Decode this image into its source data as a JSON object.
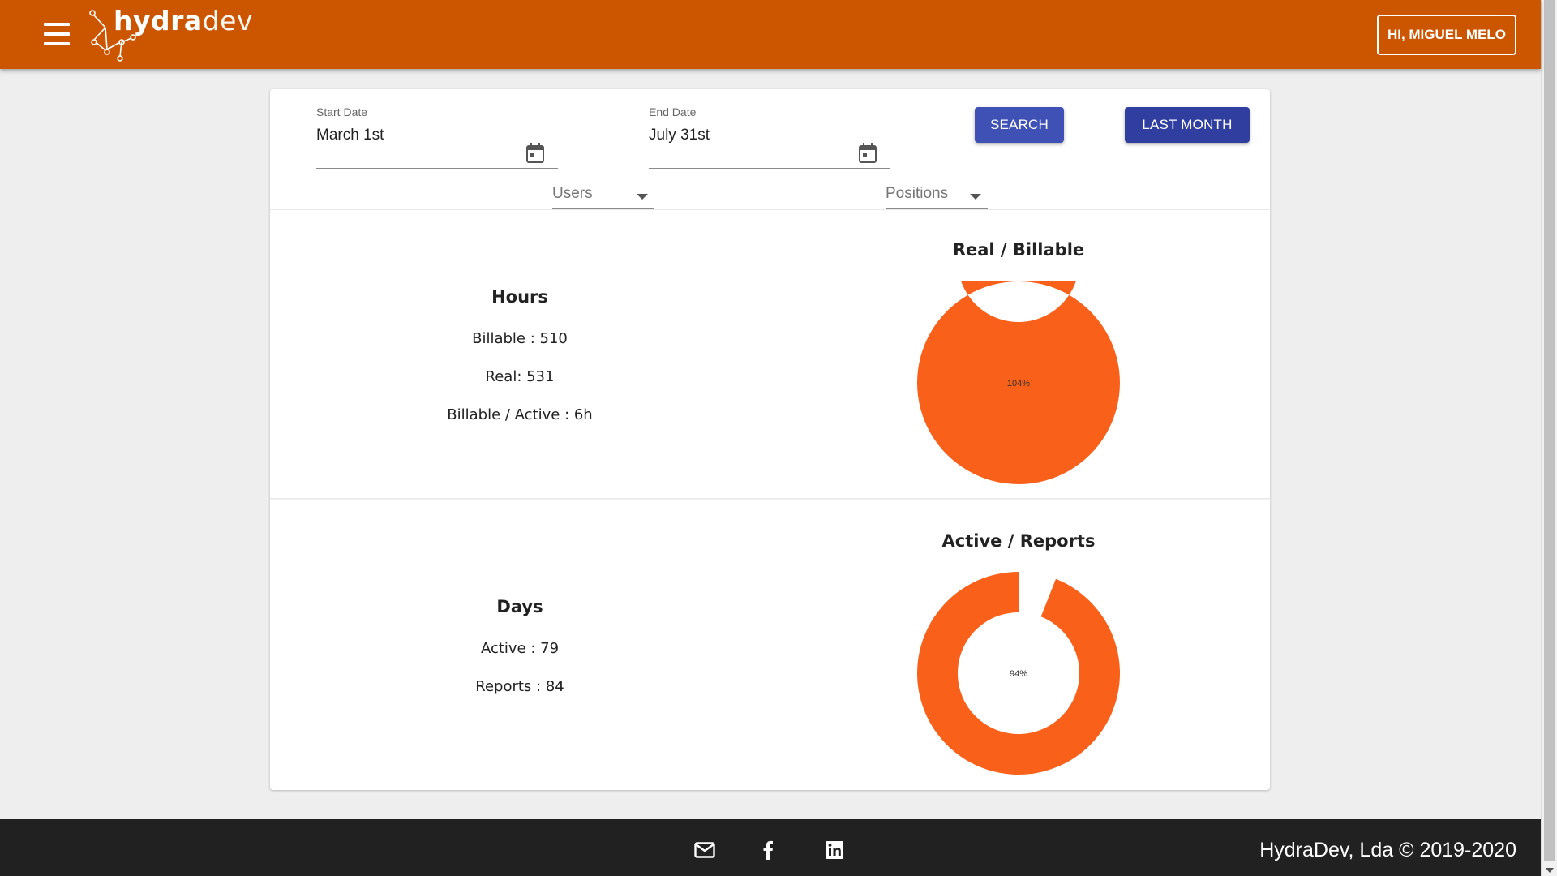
{
  "header": {
    "brand_bold": "hydra",
    "brand_light": "dev",
    "greeting": "HI, MIGUEL MELO",
    "icons": [
      "menu-icon",
      "hydradev-logo"
    ]
  },
  "filters": {
    "start_date": {
      "label": "Start Date",
      "value": "March 1st"
    },
    "end_date": {
      "label": "End Date",
      "value": "July 31st"
    },
    "search_label": "SEARCH",
    "last_month_label": "LAST MONTH",
    "users_select": "Users",
    "positions_select": "Positions"
  },
  "hours": {
    "title": "Hours",
    "billable": "Billable : 510",
    "real": "Real: 531",
    "billable_active": "Billable / Active : 6h"
  },
  "days": {
    "title": "Days",
    "active": "Active : 79",
    "reports": "Reports : 84"
  },
  "chart_data": [
    {
      "type": "pie",
      "title": "Real / Billable",
      "center_label": "104%",
      "percent": 104,
      "color": "#f9601a"
    },
    {
      "type": "pie",
      "title": "Active / Reports",
      "center_label": "94%",
      "percent": 94,
      "color": "#f9601a"
    }
  ],
  "footer": {
    "copyright": "HydraDev, Lda © 2019-2020",
    "icons": [
      "email-icon",
      "facebook-icon",
      "linkedin-icon"
    ]
  },
  "colors": {
    "header": "#cc5500",
    "primary_button": "#3f51b5",
    "secondary_button": "#303f9f",
    "donut": "#f9601a",
    "footer": "#212121"
  }
}
